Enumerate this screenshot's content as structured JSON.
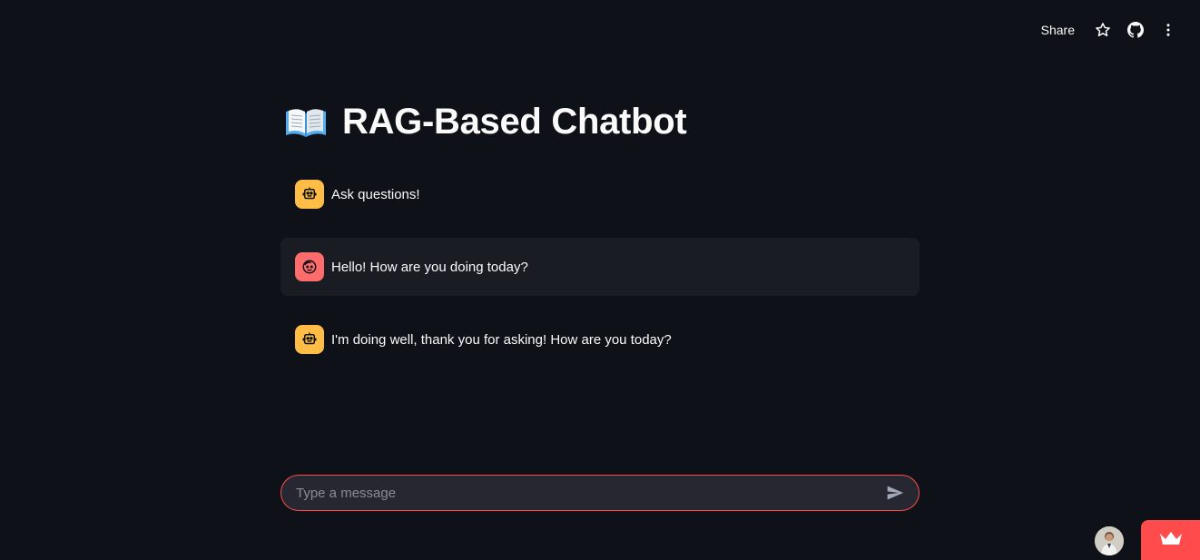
{
  "toolbar": {
    "share_label": "Share",
    "icons": [
      "star-icon",
      "github-icon",
      "more-vertical-icon"
    ]
  },
  "header": {
    "title": "RAG-Based Chatbot",
    "title_icon": "open-book-icon"
  },
  "messages": [
    {
      "role": "assistant",
      "avatar": "robot-icon",
      "text": "Ask questions!"
    },
    {
      "role": "user",
      "avatar": "smiley-face-icon",
      "text": "Hello! How are you doing today?"
    },
    {
      "role": "assistant",
      "avatar": "robot-icon",
      "text": "I'm doing well, thank you for asking! How are you today?"
    }
  ],
  "chat_input": {
    "placeholder": "Type a message",
    "value": ""
  },
  "colors": {
    "background": "#0e1117",
    "user_bubble": "#1a1c24",
    "assistant_avatar": "#ffbd45",
    "user_avatar": "#ff6c6c",
    "accent": "#ff4b4b",
    "input_bg": "#262730"
  }
}
